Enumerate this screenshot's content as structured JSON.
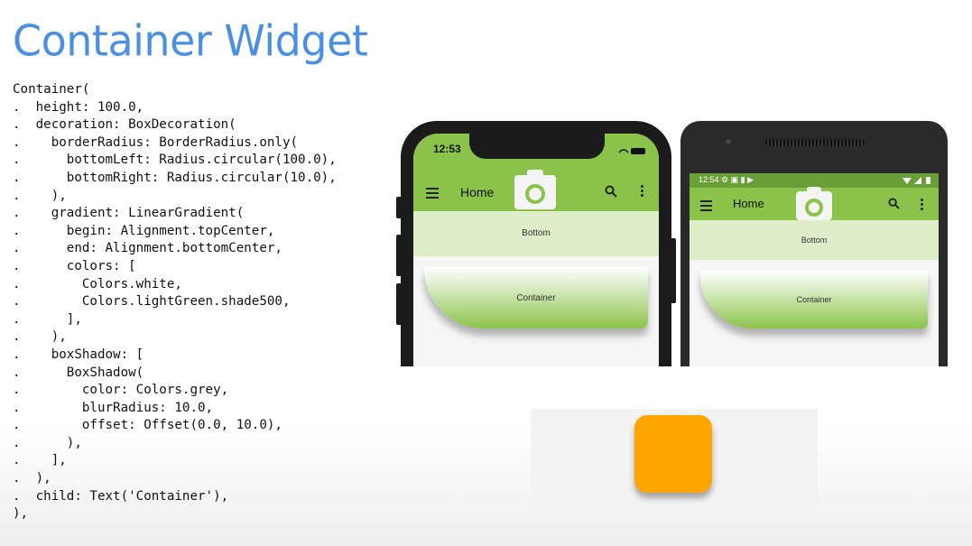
{
  "slide": {
    "title": "Container Widget"
  },
  "code_lines": [
    "Container(",
    ".  height: 100.0,",
    ".  decoration: BoxDecoration(",
    ".    borderRadius: BorderRadius.only(",
    ".      bottomLeft: Radius.circular(100.0),",
    ".      bottomRight: Radius.circular(10.0),",
    ".    ),",
    ".    gradient: LinearGradient(",
    ".      begin: Alignment.topCenter,",
    ".      end: Alignment.bottomCenter,",
    ".      colors: [",
    ".        Colors.white,",
    ".        Colors.lightGreen.shade500,",
    ".      ],",
    ".    ),",
    ".    boxShadow: [",
    ".      BoxShadow(",
    ".        color: Colors.grey,",
    ".        blurRadius: 10.0,",
    ".        offset: Offset(0.0, 10.0),",
    ".      ),",
    ".    ],",
    ".  ),",
    ".  child: Text('Container'),",
    "),"
  ],
  "ios": {
    "time": "12:53",
    "appbar_title": "Home",
    "bottom_label": "Bottom",
    "container_label": "Container"
  },
  "android": {
    "status": "12:54 ⚙ ▣ ▮ ▶",
    "appbar_title": "Home",
    "bottom_label": "Bottom",
    "container_label": "Container"
  },
  "colors": {
    "title": "#4a8fe0",
    "app_green": "#8bc34a",
    "bottom_green": "#dcedc8",
    "orange": "#ffa500"
  }
}
